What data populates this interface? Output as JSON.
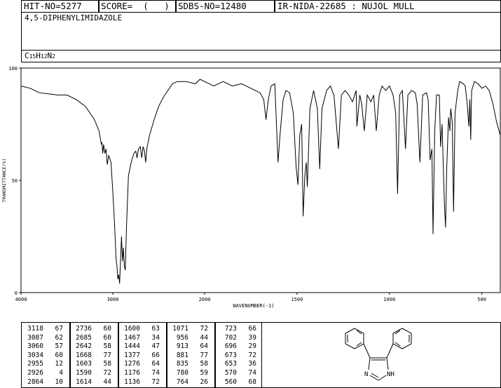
{
  "header": {
    "hit_no": "HIT-NO=5277",
    "score": "SCORE=  (   )",
    "sdbs_no": "SDBS-NO=12480",
    "ir_info": "IR-NIDA-22685 : NUJOL MULL"
  },
  "compound": {
    "name": "4,5-DIPHENYLIMIDAZOLE",
    "formula_c": "C",
    "formula_c_n": "15",
    "formula_h": "H",
    "formula_h_n": "12",
    "formula_n": "N",
    "formula_n_n": "2"
  },
  "chart_data": {
    "type": "line",
    "xlabel": "WAVENUMBER(-1)",
    "ylabel": "TRANSMITTANCE(%)",
    "xlim": [
      4000,
      400
    ],
    "ylim": [
      0,
      100
    ],
    "x_ticks": [
      4000,
      3000,
      2000,
      1500,
      1000,
      500
    ],
    "y_ticks": [
      0,
      50,
      100
    ],
    "spectrum": [
      [
        4000,
        92
      ],
      [
        3900,
        91
      ],
      [
        3800,
        89
      ],
      [
        3700,
        88.5
      ],
      [
        3600,
        88
      ],
      [
        3500,
        88
      ],
      [
        3400,
        86
      ],
      [
        3300,
        83
      ],
      [
        3250,
        80
      ],
      [
        3200,
        77
      ],
      [
        3150,
        72
      ],
      [
        3125,
        66
      ],
      [
        3118,
        67
      ],
      [
        3110,
        62
      ],
      [
        3100,
        66
      ],
      [
        3087,
        62
      ],
      [
        3075,
        64
      ],
      [
        3060,
        57
      ],
      [
        3045,
        61
      ],
      [
        3034,
        60
      ],
      [
        3020,
        58
      ],
      [
        3000,
        45
      ],
      [
        2980,
        30
      ],
      [
        2965,
        15
      ],
      [
        2955,
        12
      ],
      [
        2945,
        6
      ],
      [
        2935,
        8
      ],
      [
        2926,
        4
      ],
      [
        2915,
        15
      ],
      [
        2905,
        25
      ],
      [
        2895,
        14
      ],
      [
        2885,
        20
      ],
      [
        2875,
        12
      ],
      [
        2864,
        10
      ],
      [
        2850,
        30
      ],
      [
        2830,
        52
      ],
      [
        2800,
        58
      ],
      [
        2770,
        62
      ],
      [
        2750,
        63
      ],
      [
        2736,
        60
      ],
      [
        2720,
        64
      ],
      [
        2700,
        65
      ],
      [
        2685,
        60
      ],
      [
        2670,
        65
      ],
      [
        2655,
        63
      ],
      [
        2642,
        58
      ],
      [
        2630,
        64
      ],
      [
        2600,
        70
      ],
      [
        2550,
        77
      ],
      [
        2500,
        83
      ],
      [
        2450,
        87
      ],
      [
        2400,
        90
      ],
      [
        2350,
        93
      ],
      [
        2300,
        94
      ],
      [
        2200,
        94
      ],
      [
        2100,
        93
      ],
      [
        2050,
        95
      ],
      [
        2000,
        94
      ],
      [
        1950,
        92
      ],
      [
        1900,
        94
      ],
      [
        1850,
        92
      ],
      [
        1800,
        93
      ],
      [
        1750,
        91
      ],
      [
        1700,
        89
      ],
      [
        1680,
        86
      ],
      [
        1668,
        77
      ],
      [
        1655,
        86
      ],
      [
        1640,
        92
      ],
      [
        1620,
        93
      ],
      [
        1603,
        58
      ],
      [
        1590,
        72
      ],
      [
        1575,
        86
      ],
      [
        1560,
        90
      ],
      [
        1540,
        89
      ],
      [
        1520,
        80
      ],
      [
        1505,
        56
      ],
      [
        1495,
        48
      ],
      [
        1485,
        70
      ],
      [
        1475,
        75
      ],
      [
        1467,
        34
      ],
      [
        1458,
        52
      ],
      [
        1450,
        58
      ],
      [
        1444,
        47
      ],
      [
        1430,
        82
      ],
      [
        1410,
        90
      ],
      [
        1390,
        82
      ],
      [
        1377,
        55
      ],
      [
        1365,
        82
      ],
      [
        1340,
        90
      ],
      [
        1320,
        92
      ],
      [
        1300,
        88
      ],
      [
        1276,
        64
      ],
      [
        1260,
        88
      ],
      [
        1240,
        90
      ],
      [
        1220,
        88
      ],
      [
        1200,
        85
      ],
      [
        1180,
        90
      ],
      [
        1176,
        74
      ],
      [
        1160,
        88
      ],
      [
        1150,
        84
      ],
      [
        1136,
        72
      ],
      [
        1120,
        88
      ],
      [
        1100,
        85
      ],
      [
        1085,
        88
      ],
      [
        1071,
        72
      ],
      [
        1055,
        88
      ],
      [
        1040,
        92
      ],
      [
        1020,
        90
      ],
      [
        1000,
        92
      ],
      [
        980,
        88
      ],
      [
        966,
        80
      ],
      [
        956,
        44
      ],
      [
        945,
        88
      ],
      [
        930,
        90
      ],
      [
        913,
        64
      ],
      [
        900,
        88
      ],
      [
        880,
        90
      ],
      [
        860,
        89
      ],
      [
        850,
        84
      ],
      [
        835,
        58
      ],
      [
        820,
        88
      ],
      [
        800,
        89
      ],
      [
        790,
        86
      ],
      [
        780,
        59
      ],
      [
        770,
        64
      ],
      [
        764,
        26
      ],
      [
        755,
        72
      ],
      [
        745,
        88
      ],
      [
        730,
        88
      ],
      [
        723,
        65
      ],
      [
        715,
        75
      ],
      [
        702,
        39
      ],
      [
        696,
        29
      ],
      [
        690,
        55
      ],
      [
        680,
        78
      ],
      [
        673,
        72
      ],
      [
        668,
        82
      ],
      [
        660,
        76
      ],
      [
        653,
        36
      ],
      [
        645,
        80
      ],
      [
        630,
        90
      ],
      [
        620,
        94
      ],
      [
        600,
        93
      ],
      [
        590,
        92
      ],
      [
        580,
        85
      ],
      [
        570,
        74
      ],
      [
        565,
        86
      ],
      [
        560,
        68
      ],
      [
        555,
        90
      ],
      [
        540,
        94
      ],
      [
        520,
        93
      ],
      [
        500,
        91
      ],
      [
        480,
        92
      ],
      [
        460,
        90
      ],
      [
        440,
        84
      ],
      [
        420,
        76
      ],
      [
        400,
        70
      ]
    ],
    "peaks": [
      {
        "wn": 3118,
        "t": 67
      },
      {
        "wn": 3087,
        "t": 62
      },
      {
        "wn": 3060,
        "t": 57
      },
      {
        "wn": 3034,
        "t": 60
      },
      {
        "wn": 2955,
        "t": 12
      },
      {
        "wn": 2926,
        "t": 4
      },
      {
        "wn": 2864,
        "t": 10
      },
      {
        "wn": 2736,
        "t": 60
      },
      {
        "wn": 2685,
        "t": 60
      },
      {
        "wn": 2642,
        "t": 58
      },
      {
        "wn": 1668,
        "t": 77
      },
      {
        "wn": 1603,
        "t": 58
      },
      {
        "wn": 1590,
        "t": 72
      },
      {
        "wn": 1614,
        "t": 44
      },
      {
        "wn": 1600,
        "t": 63
      },
      {
        "wn": 1467,
        "t": 34
      },
      {
        "wn": 1444,
        "t": 47
      },
      {
        "wn": 1377,
        "t": 66
      },
      {
        "wn": 1276,
        "t": 64
      },
      {
        "wn": 1176,
        "t": 74
      },
      {
        "wn": 1136,
        "t": 72
      },
      {
        "wn": 1071,
        "t": 72
      },
      {
        "wn": 956,
        "t": 44
      },
      {
        "wn": 913,
        "t": 64
      },
      {
        "wn": 881,
        "t": 77
      },
      {
        "wn": 835,
        "t": 58
      },
      {
        "wn": 780,
        "t": 59
      },
      {
        "wn": 764,
        "t": 26
      },
      {
        "wn": 723,
        "t": 66
      },
      {
        "wn": 702,
        "t": 39
      },
      {
        "wn": 696,
        "t": 29
      },
      {
        "wn": 673,
        "t": 72
      },
      {
        "wn": 653,
        "t": 36
      },
      {
        "wn": 570,
        "t": 74
      },
      {
        "wn": 560,
        "t": 68
      }
    ]
  },
  "peak_table": {
    "columns": [
      [
        [
          "3118",
          "67"
        ],
        [
          "3087",
          "62"
        ],
        [
          "3060",
          "57"
        ],
        [
          "3034",
          "60"
        ],
        [
          "2955",
          "12"
        ],
        [
          "2926",
          "4"
        ],
        [
          "2864",
          "10"
        ]
      ],
      [
        [
          "2736",
          "60"
        ],
        [
          "2685",
          "60"
        ],
        [
          "2642",
          "58"
        ],
        [
          "1668",
          "77"
        ],
        [
          "1603",
          "58"
        ],
        [
          "1590",
          "72"
        ],
        [
          "1614",
          "44"
        ]
      ],
      [
        [
          "1600",
          "63"
        ],
        [
          "1467",
          "34"
        ],
        [
          "1444",
          "47"
        ],
        [
          "1377",
          "66"
        ],
        [
          "1276",
          "64"
        ],
        [
          "1176",
          "74"
        ],
        [
          "1136",
          "72"
        ]
      ],
      [
        [
          "1071",
          "72"
        ],
        [
          "956",
          "44"
        ],
        [
          "913",
          "64"
        ],
        [
          "881",
          "77"
        ],
        [
          "835",
          "58"
        ],
        [
          "780",
          "59"
        ],
        [
          "764",
          "26"
        ]
      ],
      [
        [
          "723",
          "66"
        ],
        [
          "702",
          "39"
        ],
        [
          "696",
          "29"
        ],
        [
          "673",
          "72"
        ],
        [
          "653",
          "36"
        ],
        [
          "570",
          "74"
        ],
        [
          "560",
          "68"
        ]
      ]
    ]
  },
  "structure": {
    "n_label": "N",
    "nh_label": "NH"
  }
}
